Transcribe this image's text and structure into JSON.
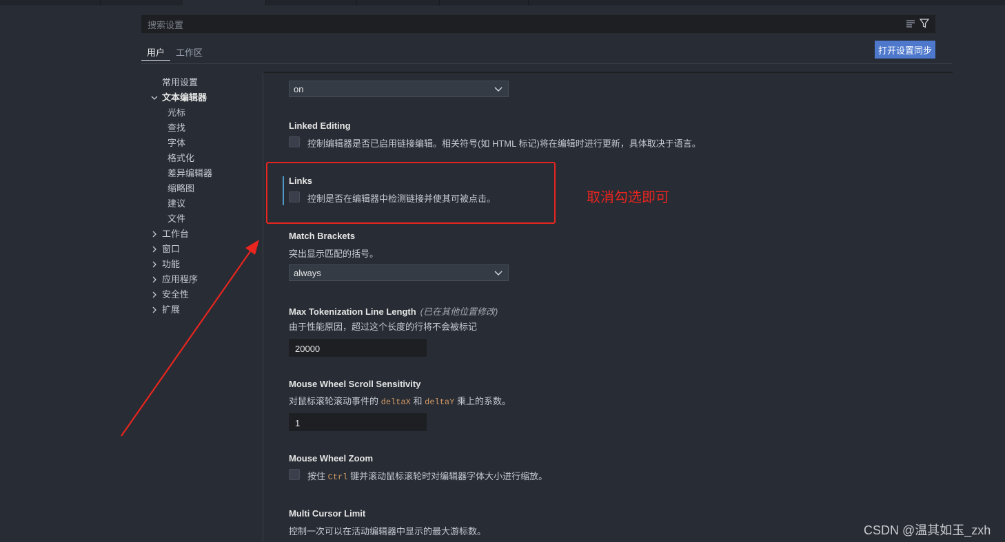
{
  "search": {
    "placeholder": "搜索设置",
    "clear_filter_icon": "filter-list-icon",
    "filter_icon": "funnel-icon"
  },
  "scope_tabs": [
    {
      "label": "用户",
      "active": true
    },
    {
      "label": "工作区",
      "active": false
    }
  ],
  "sync_button": "打开设置同步",
  "toc": {
    "items": [
      {
        "label": "常用设置",
        "level": 0,
        "expand": "none",
        "bold": false
      },
      {
        "label": "文本编辑器",
        "level": 0,
        "expand": "expanded",
        "bold": true
      },
      {
        "label": "光标",
        "level": 1,
        "expand": "none",
        "bold": false
      },
      {
        "label": "查找",
        "level": 1,
        "expand": "none",
        "bold": false
      },
      {
        "label": "字体",
        "level": 1,
        "expand": "none",
        "bold": false
      },
      {
        "label": "格式化",
        "level": 1,
        "expand": "none",
        "bold": false
      },
      {
        "label": "差异编辑器",
        "level": 1,
        "expand": "none",
        "bold": false
      },
      {
        "label": "缩略图",
        "level": 1,
        "expand": "none",
        "bold": false
      },
      {
        "label": "建议",
        "level": 1,
        "expand": "none",
        "bold": false
      },
      {
        "label": "文件",
        "level": 1,
        "expand": "none",
        "bold": false
      },
      {
        "label": "工作台",
        "level": 0,
        "expand": "collapsed",
        "bold": false
      },
      {
        "label": "窗口",
        "level": 0,
        "expand": "collapsed",
        "bold": false
      },
      {
        "label": "功能",
        "level": 0,
        "expand": "collapsed",
        "bold": false
      },
      {
        "label": "应用程序",
        "level": 0,
        "expand": "collapsed",
        "bold": false
      },
      {
        "label": "安全性",
        "level": 0,
        "expand": "collapsed",
        "bold": false
      },
      {
        "label": "扩展",
        "level": 0,
        "expand": "collapsed",
        "bold": false
      }
    ]
  },
  "settings": {
    "top_select": {
      "value": "on"
    },
    "linked_editing": {
      "title": "Linked Editing",
      "description": "控制编辑器是否已启用链接编辑。相关符号(如 HTML 标记)将在编辑时进行更新，具体取决于语言。",
      "checked": false
    },
    "links": {
      "title": "Links",
      "description": "控制是否在编辑器中检测链接并使其可被点击。",
      "checked": false
    },
    "match_brackets": {
      "title": "Match Brackets",
      "description": "突出显示匹配的括号。",
      "value": "always"
    },
    "max_tokenization": {
      "title": "Max Tokenization Line Length",
      "modified_note": "(已在其他位置修改)",
      "description": "由于性能原因，超过这个长度的行将不会被标记",
      "value": "20000"
    },
    "mouse_wheel_scroll": {
      "title": "Mouse Wheel Scroll Sensitivity",
      "desc_before": "对鼠标滚轮滚动事件的",
      "code1": "deltaX",
      "desc_mid": "和",
      "code2": "deltaY",
      "desc_after": "乘上的系数。",
      "value": "1"
    },
    "mouse_wheel_zoom": {
      "title": "Mouse Wheel Zoom",
      "desc_before": "按住",
      "code": "Ctrl",
      "desc_after": "键并滚动鼠标滚轮时对编辑器字体大小进行缩放。",
      "checked": false
    },
    "multi_cursor_limit": {
      "title": "Multi Cursor Limit",
      "description": "控制一次可以在活动编辑器中显示的最大游标数。"
    }
  },
  "annotation": {
    "text": "取消勾选即可",
    "color": "#e8251f"
  },
  "watermark": "CSDN @温其如玉_zxh",
  "colors": {
    "background": "#282c34",
    "accent_button": "#4d78cc",
    "focus_bar": "#4d9ac9"
  }
}
